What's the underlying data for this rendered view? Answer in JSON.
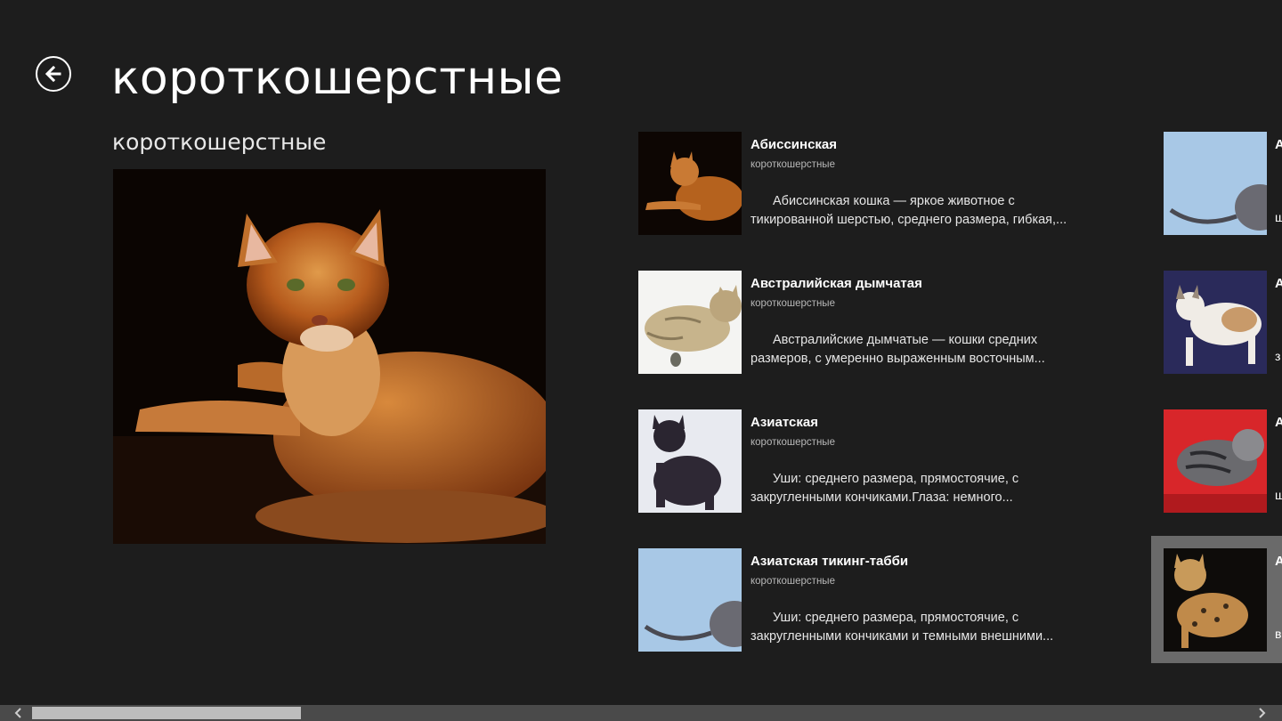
{
  "header": {
    "title": "короткошерстные",
    "back_icon": "arrow-left-circle-icon"
  },
  "group": {
    "header": "короткошерстные"
  },
  "items": [
    {
      "title": "Абиссинская",
      "subtitle": "короткошерстные",
      "description": "Абиссинская кошка — яркое животное с тикированной шерстью, среднего размера, гибкая,..."
    },
    {
      "title": "Австралийская дымчатая",
      "subtitle": "короткошерстные",
      "description": "Австралийские дымчатые — кошки средних размеров, с умеренно выраженным восточным..."
    },
    {
      "title": "Азиатская",
      "subtitle": "короткошерстные",
      "description": "Уши: среднего размера, прямостоячие, с закругленными кончиками.Глаза: немного..."
    },
    {
      "title": "Азиатская тикинг-табби",
      "subtitle": "короткошерстные",
      "description": "Уши: среднего размера, прямостоячие, с закругленными кончиками и темными внешними..."
    }
  ],
  "partial_column": {
    "letters": [
      "А",
      "А",
      "А",
      "А"
    ],
    "desc_letters": [
      "ш",
      "з",
      "ш",
      "в"
    ]
  },
  "scrollbar": {
    "left_icon": "chevron-left-icon",
    "right_icon": "chevron-right-icon"
  }
}
